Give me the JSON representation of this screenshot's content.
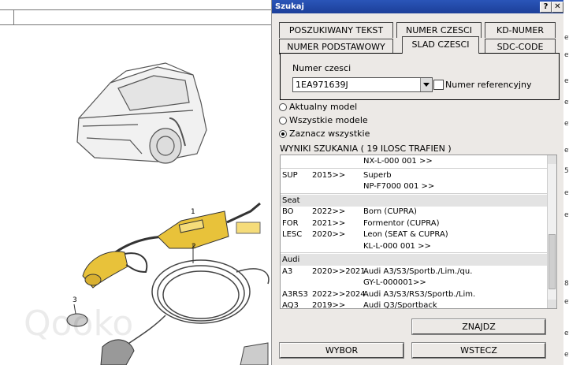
{
  "window": {
    "title": "Szukaj",
    "help_label": "?",
    "close_label": "✕"
  },
  "tabs": [
    {
      "label": "POSZUKIWANY TEKST"
    },
    {
      "label": "NUMER CZESCI"
    },
    {
      "label": "KD-NUMER"
    },
    {
      "label": "NUMER PODSTAWOWY"
    },
    {
      "label": "SLAD CZESCI"
    },
    {
      "label": "SDC-CODE"
    }
  ],
  "search_panel": {
    "label": "Numer czesci",
    "value": "1EA971639J",
    "reference_checkbox_label": "Numer referencyjny"
  },
  "model_options": [
    {
      "label": "Aktualny model",
      "selected": false
    },
    {
      "label": "Wszystkie modele",
      "selected": false
    },
    {
      "label": "Zaznacz wszystkie",
      "selected": true
    }
  ],
  "results_header": "WYNIKI SZUKANIA  ( 19 ILOSC TRAFIEN )",
  "results": [
    {
      "type": "row",
      "code": "",
      "year": "",
      "desc": "NX-L-000 001 >>"
    },
    {
      "type": "sep"
    },
    {
      "type": "row",
      "code": "SUP",
      "year": "2015>>",
      "desc": "Superb"
    },
    {
      "type": "row",
      "code": "",
      "year": "",
      "desc": "NP-F7000 001 >>"
    },
    {
      "type": "sep"
    },
    {
      "type": "group",
      "code": "Seat"
    },
    {
      "type": "row",
      "code": "BO",
      "year": "2022>>",
      "desc": "Born (CUPRA)"
    },
    {
      "type": "row",
      "code": "FOR",
      "year": "2021>>",
      "desc": "Formentor (CUPRA)"
    },
    {
      "type": "row",
      "code": "LESC",
      "year": "2020>>",
      "desc": "Leon (SEAT & CUPRA)"
    },
    {
      "type": "row",
      "code": "",
      "year": "",
      "desc": "KL-L-000 001 >>"
    },
    {
      "type": "sep"
    },
    {
      "type": "group",
      "code": "Audi"
    },
    {
      "type": "row",
      "code": "A3",
      "year": "2020>>2021",
      "desc": "Audi A3/S3/Sportb./Lim./qu."
    },
    {
      "type": "row",
      "code": "",
      "year": "",
      "desc": "GY-L-000001>>"
    },
    {
      "type": "row",
      "code": "A3RS3",
      "year": "2022>>2024",
      "desc": "Audi A3/S3/RS3/Sportb./Lim."
    },
    {
      "type": "row",
      "code": "AQ3",
      "year": "2019>>",
      "desc": "Audi Q3/Sportback"
    }
  ],
  "buttons": {
    "find": "ZNAJDZ",
    "select": "WYBOR",
    "back": "WSTECZ"
  },
  "diagram": {
    "callouts": [
      "1",
      "2",
      "3"
    ],
    "watermark": "Qooko"
  },
  "right_edge_labels": [
    "ev",
    "ev",
    "ev",
    "ev",
    "ev",
    "ev",
    "5",
    "ev",
    "ev",
    "8",
    "ev",
    "ev",
    "ev"
  ],
  "colors": {
    "titlebar": "#1c3f99",
    "dialog_bg": "#ece9e6",
    "charger_yellow": "#e8c23a"
  }
}
